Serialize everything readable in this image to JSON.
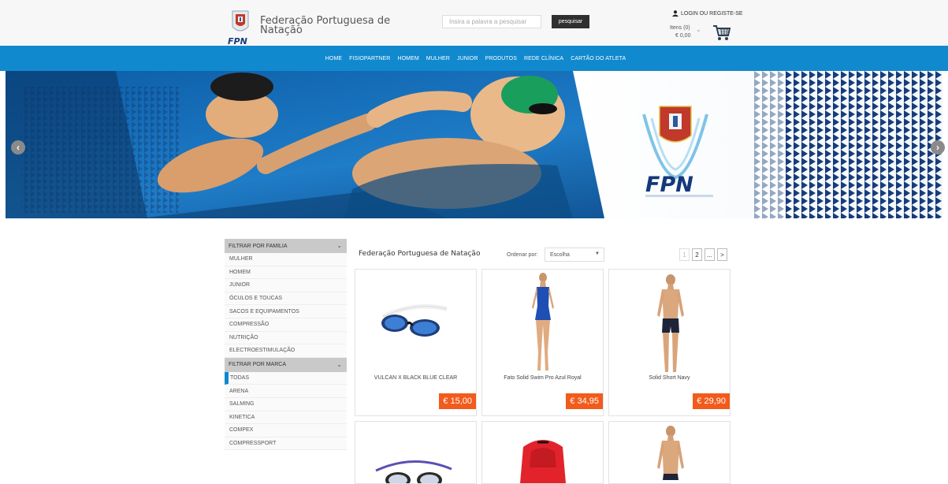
{
  "header": {
    "site_title": "Federação Portuguesa de Natação",
    "search_placeholder": "Insira a palavra a pesquisar",
    "search_button": "pesquisar",
    "login_label": "LOGIN OU REGISTE-SE",
    "cart_items": "Itens (0)",
    "cart_total": "€ 0,00"
  },
  "nav": {
    "items": [
      "HOME",
      "FISIOPARTNER",
      "HOMEM",
      "MULHER",
      "JUNIOR",
      "PRODUTOS",
      "REDE CLÍNICA",
      "CARTÃO DO ATLETA"
    ]
  },
  "hero": {
    "logo_text": "FPN"
  },
  "sidebar": {
    "family_header": "FILTRAR POR FAMILIA",
    "families": [
      "MULHER",
      "HOMEM",
      "JUNIOR",
      "ÓCULOS E TOUCAS",
      "SACOS E EQUIPAMENTOS",
      "COMPRESSÃO",
      "NUTRIÇÃO",
      "ELECTROESTIMULAÇÃO"
    ],
    "brand_header": "FILTRAR POR MARCA",
    "brands": [
      "TODAS",
      "ARENA",
      "SALMING",
      "KINETICA",
      "COMPEX",
      "COMPRESSPORT"
    ]
  },
  "content": {
    "title": "Federação Portuguesa de Natação",
    "sort_label": "Ordenar por:",
    "sort_value": "Escolha",
    "pager": [
      "1",
      "2",
      "...",
      ">"
    ]
  },
  "products": [
    {
      "name": "VULCAN X BLACK BLUE CLEAR",
      "price": "€ 15,00",
      "icon": "goggles-icon"
    },
    {
      "name": "Fato Solid Swim Pro Azul Royal",
      "price": "€ 34,95",
      "icon": "swimsuit-icon"
    },
    {
      "name": "Solid Short Navy",
      "price": "€ 29,90",
      "icon": "swim-short-icon"
    }
  ],
  "colors": {
    "nav_blue": "#1189ce",
    "price_orange": "#f25b1b"
  }
}
